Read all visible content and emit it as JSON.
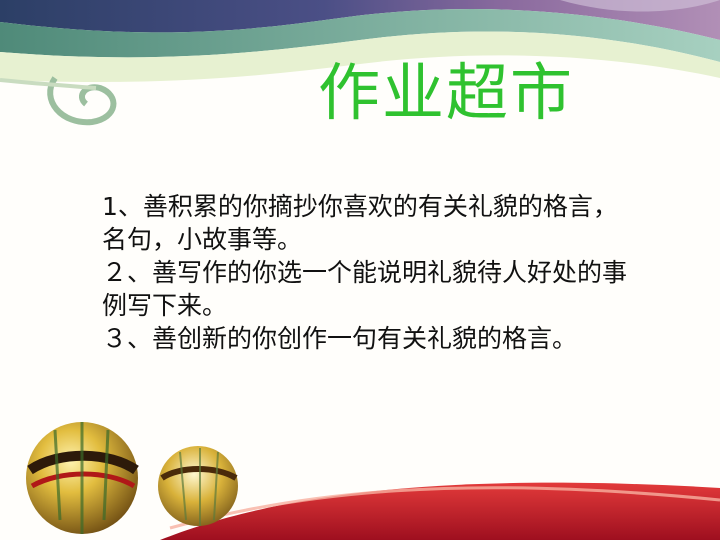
{
  "slide": {
    "title": "作业超市",
    "items": [
      "1、善积累的你摘抄你喜欢的有关礼貌的格言，名句，小故事等。",
      "２、善写作的你选一个能说明礼貌待人好处的事例写下来。",
      "３、善创新的你创作一句有关礼貌的格言。"
    ]
  },
  "colors": {
    "title": "#2fc22f",
    "text": "#111111",
    "banner_dark": "#344a74",
    "banner_purple": "#6a4f8a",
    "ribbon_teal": "#5f9b86",
    "scroll_cream": "#e9f3d2",
    "bottom_red": "#c8142a",
    "ball_gold": "#d9b23a"
  },
  "icons": [
    "scroll-banner-decoration",
    "golden-ball-icon",
    "red-ribbon-decoration"
  ]
}
